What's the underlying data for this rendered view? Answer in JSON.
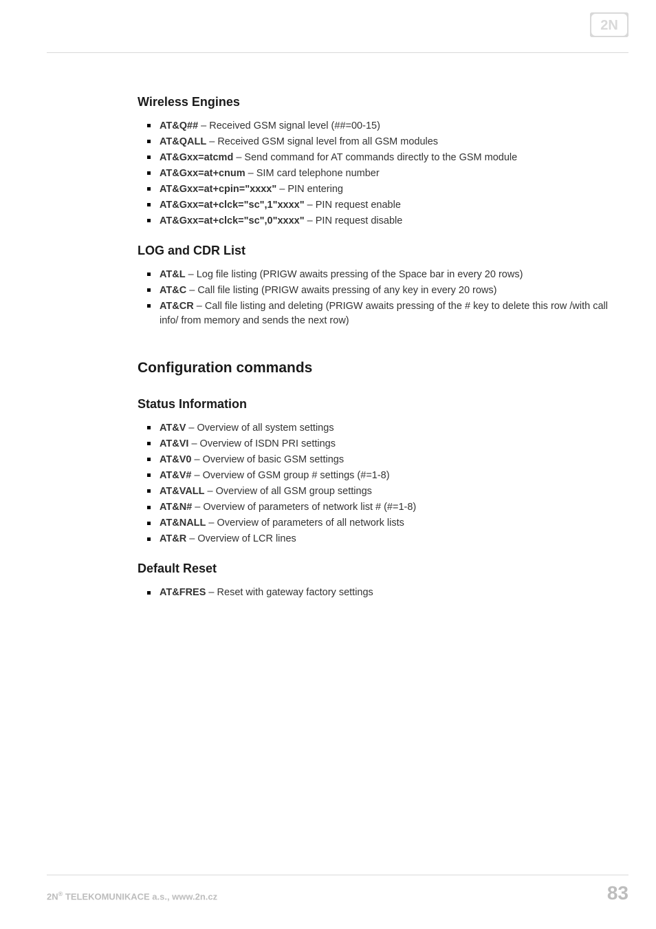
{
  "logo_alt": "2N",
  "sections": {
    "wireless": {
      "title": "Wireless Engines",
      "items": [
        {
          "cmd": "AT&Q##",
          "desc": " – Received GSM signal level (##=00-15)"
        },
        {
          "cmd": "AT&QALL",
          "desc": " – Received GSM signal level from all GSM modules"
        },
        {
          "cmd": "AT&Gxx=atcmd",
          "desc": " – Send command for AT commands directly to the GSM module"
        },
        {
          "cmd": "AT&Gxx=at+cnum",
          "desc": " – SIM card telephone number"
        },
        {
          "cmd": "AT&Gxx=at+cpin=\"xxxx\"",
          "desc": " – PIN entering"
        },
        {
          "cmd": "AT&Gxx=at+clck=\"sc\",1\"xxxx\"",
          "desc": " – PIN request enable"
        },
        {
          "cmd": "AT&Gxx=at+clck=\"sc\",0\"xxxx\"",
          "desc": " – PIN request disable"
        }
      ]
    },
    "logcdr": {
      "title": "LOG and CDR List",
      "items": [
        {
          "cmd": "AT&L",
          "desc": " – Log file listing (PRIGW awaits pressing of the Space bar in every 20 rows)"
        },
        {
          "cmd": "AT&C",
          "desc": " – Call file listing (PRIGW awaits pressing of any key in every 20 rows)"
        },
        {
          "cmd": "AT&CR",
          "desc": " – Call file listing and deleting (PRIGW awaits pressing of the # key to delete this row /with call info/ from memory and sends the next row)"
        }
      ]
    },
    "config_heading": "Configuration commands",
    "status": {
      "title": "Status Information",
      "items": [
        {
          "cmd": "AT&V",
          "desc": " – Overview of all system settings"
        },
        {
          "cmd": "AT&VI",
          "desc": " – Overview of ISDN PRI settings"
        },
        {
          "cmd": "AT&V0",
          "desc": " – Overview of basic GSM settings"
        },
        {
          "cmd": "AT&V#",
          "desc": " – Overview of GSM group # settings (#=1-8)"
        },
        {
          "cmd": "AT&VALL",
          "desc": " – Overview of all GSM group settings"
        },
        {
          "cmd": "AT&N#",
          "desc": " – Overview of parameters of network list # (#=1-8)"
        },
        {
          "cmd": "AT&NALL",
          "desc": " – Overview of parameters of all network lists"
        },
        {
          "cmd": "AT&R",
          "desc": " – Overview of LCR lines"
        }
      ]
    },
    "reset": {
      "title": "Default Reset",
      "items": [
        {
          "cmd": "AT&FRES",
          "desc": " – Reset with gateway factory settings"
        }
      ]
    }
  },
  "footer": {
    "company_prefix": "2N",
    "company_sup": "®",
    "company_rest": " TELEKOMUNIKACE a.s., www.2n.cz",
    "page_no": "83"
  }
}
